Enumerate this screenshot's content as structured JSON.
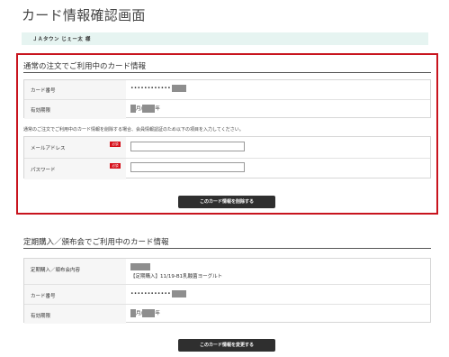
{
  "page": {
    "title": "カード情報確認画面"
  },
  "member": {
    "name": "ＪＡタウン じぇー太 様"
  },
  "regular": {
    "title": "通常の注文でご利用中のカード情報",
    "card_number_label": "カード番号",
    "card_number_value": "••••••••••••",
    "expiry_label": "有効期限",
    "expiry_month_suffix": "月/",
    "expiry_year_suffix": "年",
    "note": "通常のご注文でご利用中のカード情報を削除する場合、会員情報認証のため以下の項目を入力してください。",
    "email_label": "メールアドレス",
    "password_label": "パスワード",
    "required_badge": "必須",
    "email_value": "",
    "password_value": "",
    "delete_button": "このカード情報を削除する"
  },
  "subscription": {
    "title": "定期購入／頒布会でご利用中のカード情報",
    "contents_label": "定期購入／頒布会内容",
    "contents_value": "【定期購入】11/19-B1乳酸菌ヨーグルト",
    "card_number_label": "カード番号",
    "card_number_value": "••••••••••••",
    "expiry_label": "有効期限",
    "expiry_month_suffix": "月/",
    "expiry_year_suffix": "年",
    "change_button": "このカード情報を変更する"
  }
}
